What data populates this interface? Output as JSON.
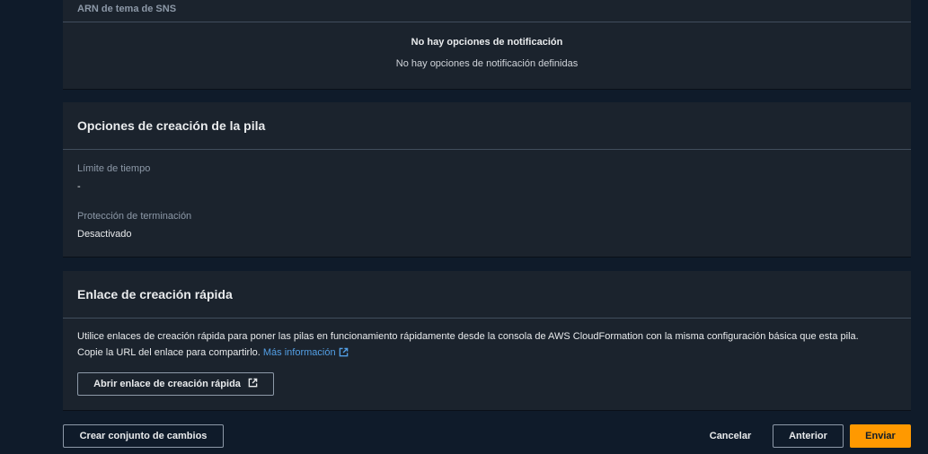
{
  "notifications": {
    "column_header": "ARN de tema de SNS",
    "empty_title": "No hay opciones de notificación",
    "empty_description": "No hay opciones de notificación definidas"
  },
  "stack_options": {
    "title": "Opciones de creación de la pila",
    "timeout_label": "Límite de tiempo",
    "timeout_value": "-",
    "termination_label": "Protección de terminación",
    "termination_value": "Desactivado"
  },
  "quick_create": {
    "title": "Enlace de creación rápida",
    "description_line1": "Utilice enlaces de creación rápida para poner las pilas en funcionamiento rápidamente desde la consola de AWS CloudFormation con la misma configuración básica que esta pila.",
    "description_line2": "Copie la URL del enlace para compartirlo.",
    "more_info_link": "Más información",
    "open_link_button": "Abrir enlace de creación rápida",
    "icons": [
      "external-link-icon"
    ]
  },
  "footer": {
    "create_change_set": "Crear conjunto de cambios",
    "cancel": "Cancelar",
    "previous": "Anterior",
    "submit": "Enviar"
  },
  "colors": {
    "background": "#0f1b2a",
    "panel": "#1b232d",
    "divider": "#414d5c",
    "link": "#539fe5",
    "primary": "#ff9900"
  }
}
